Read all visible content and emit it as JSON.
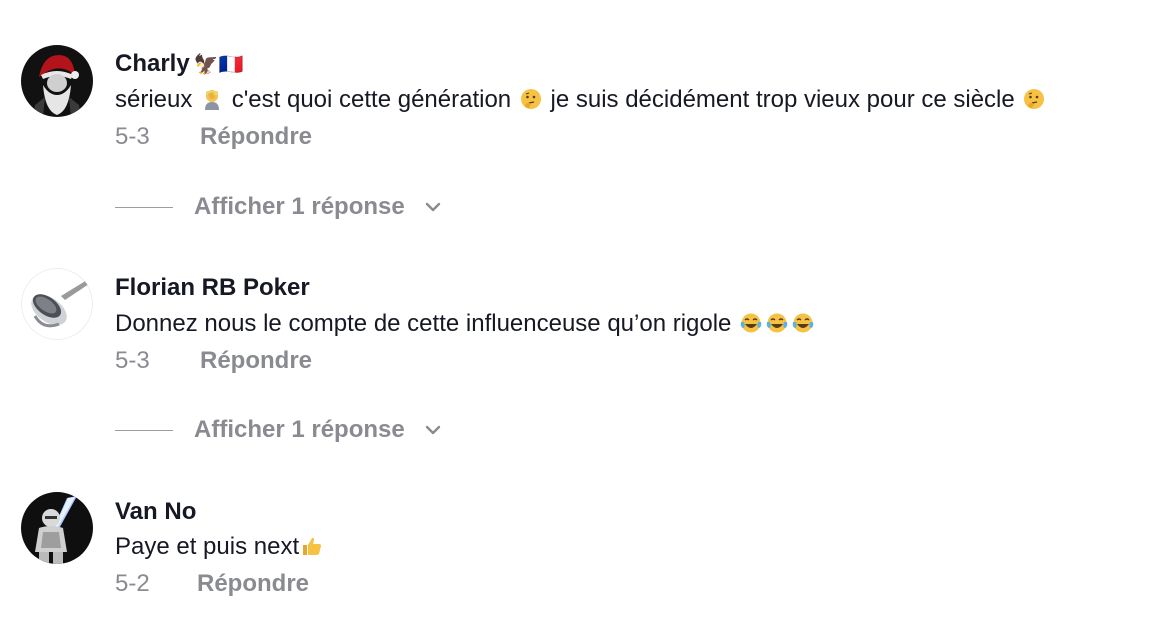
{
  "comments": [
    {
      "username": "Charly",
      "username_emojis": "🦅🇫🇷",
      "text_parts": [
        "sérieux ",
        " c'est quoi cette génération ",
        " je suis décidément trop vieux pour ce siècle "
      ],
      "emoji_names": [
        "man-facepalming-icon",
        "thinking-face-icon",
        "thinking-face-icon"
      ],
      "date": "5-3",
      "reply_label": "Répondre",
      "view_replies_label": "Afficher 1 réponse"
    },
    {
      "username": "Florian RB Poker",
      "text_parts": [
        "Donnez nous le compte de cette influenceuse qu’on rigole "
      ],
      "emoji_names": [
        "tears-of-joy-icon",
        "tears-of-joy-icon",
        "tears-of-joy-icon"
      ],
      "date": "5-3",
      "reply_label": "Répondre",
      "view_replies_label": "Afficher 1 réponse"
    },
    {
      "username": "Van No",
      "text_parts": [
        "Paye et puis next"
      ],
      "emoji_names": [
        "thumbs-up-icon"
      ],
      "date": "5-2",
      "reply_label": "Répondre"
    }
  ],
  "colors": {
    "text": "#161823",
    "secondary": "#8a8b91",
    "background": "#ffffff"
  }
}
